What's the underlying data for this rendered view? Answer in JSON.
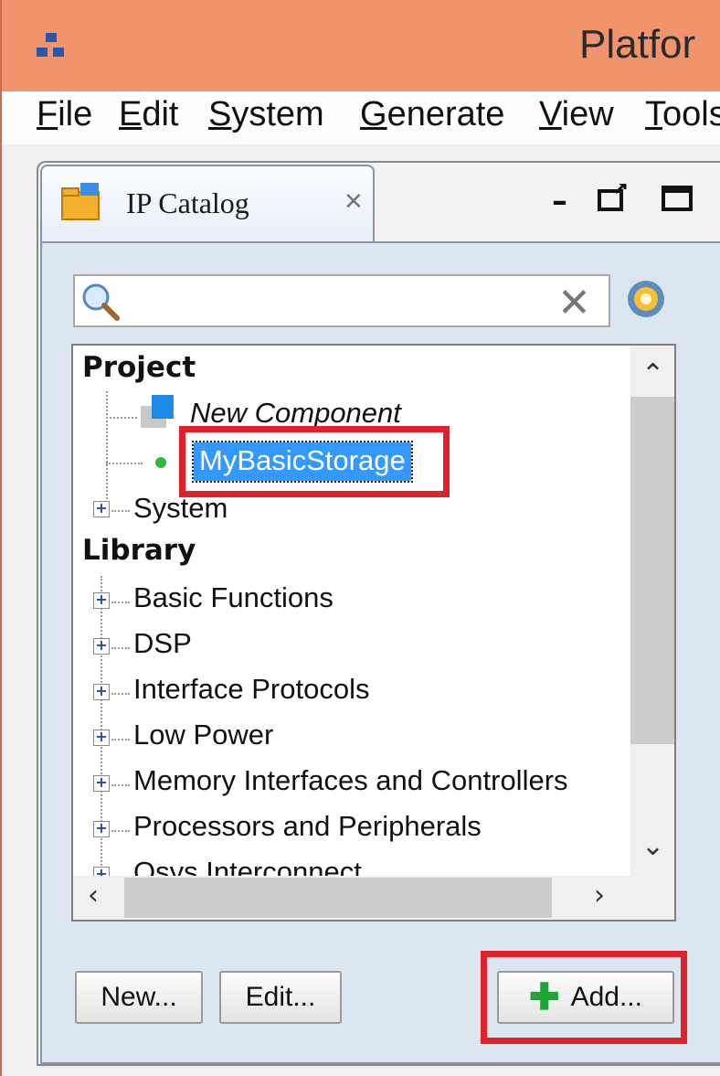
{
  "window": {
    "title": "Platfor"
  },
  "menu": [
    {
      "mnemonic": "F",
      "rest": "ile"
    },
    {
      "mnemonic": "E",
      "rest": "dit"
    },
    {
      "mnemonic": "S",
      "rest": "ystem"
    },
    {
      "mnemonic": "G",
      "rest": "enerate"
    },
    {
      "mnemonic": "V",
      "rest": "iew"
    },
    {
      "mnemonic": "T",
      "rest": "ools"
    }
  ],
  "tab": {
    "label": "IP Catalog",
    "close_icon": "close-icon"
  },
  "search": {
    "value": "",
    "placeholder": ""
  },
  "tree": {
    "project_header": "Project",
    "project_items": [
      "New Component",
      "MyBasicStorage",
      "System"
    ],
    "library_header": "Library",
    "library_items": [
      "Basic Functions",
      "DSP",
      "Interface Protocols",
      "Low Power",
      "Memory Interfaces and Controllers",
      "Processors and Peripherals",
      "Qsys Interconnect"
    ],
    "selected": "MyBasicStorage"
  },
  "buttons": {
    "new": "New...",
    "edit": "Edit...",
    "add": "Add..."
  },
  "colors": {
    "titlebar": "#f0946e",
    "selection": "#3399ff",
    "highlight": "#e0202b",
    "add_plus": "#1aa834"
  }
}
